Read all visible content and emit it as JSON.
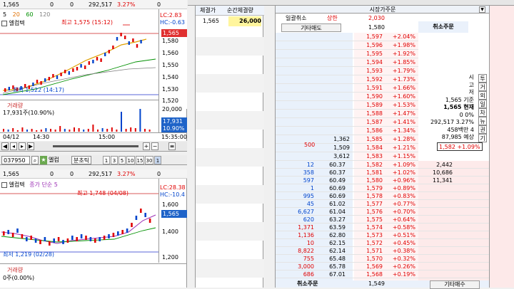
{
  "colors": {
    "up": "#e00000",
    "down": "#0044cc",
    "ask_bg": "#e9f1fb",
    "bid_bg": "#fdeaea",
    "price_col_bg": "#fff3f3",
    "accent": "#1e63c8"
  },
  "top_chart": {
    "info": {
      "price": "1,565",
      "change": "0",
      "volume": "0",
      "amount": "292,517",
      "rate": "3.27%",
      "extra": "0"
    },
    "legend": {
      "items": [
        "5",
        "20",
        "60",
        "120"
      ],
      "name": "엘컴텍"
    },
    "high_label": "최고 1,575 (15:12)",
    "low_label": "최저 1,522 (14:17)",
    "lc_label": "LC:2.83",
    "hc_label": "HC:-0.63",
    "price_box": "1,565",
    "y_ticks": [
      "1,580",
      "1,560",
      "1,550",
      "1,540",
      "1,530",
      "1,520"
    ],
    "volume_label": "거래량",
    "volume_value": "17,931주(10.90%)",
    "vol_ticks": [
      "20,000",
      "10,000"
    ],
    "vol_box": "17,931",
    "vol_box2": "10.90%",
    "x_labels": [
      "04/12",
      "14:30",
      "15:00",
      "15:35:00"
    ]
  },
  "toolbar": {
    "code": "037950",
    "name": "엘컴",
    "unit": "분초틱",
    "periods": [
      "1",
      "3",
      "5",
      "10",
      "15",
      "30",
      "1"
    ]
  },
  "bottom_chart": {
    "info": {
      "price": "1,565",
      "change": "0",
      "volume": "0",
      "amount": "292,517",
      "rate": "3.27%",
      "extra": "0"
    },
    "name": "엘컴텍",
    "legend": "종가 단순 5",
    "high_label": "최고 1,748 (04/08)",
    "low_label": "최저 1,219 (02/28)",
    "lc_label": "LC:28.38",
    "hc_label": "HC:-10.4",
    "price_box": "1,565",
    "y_ticks": [
      "1,600",
      "1,400",
      "1,200"
    ],
    "volume_label": "거래량",
    "volume_value": "0주(0.00%)"
  },
  "trades": {
    "headers": [
      "체결가",
      "순간체결량"
    ],
    "rows": [
      {
        "price": "1,565",
        "qty": "26,000"
      }
    ]
  },
  "order": {
    "title": "시장가주문",
    "top_row": {
      "a": "일괄취소",
      "b": "상한",
      "c": "2,030"
    },
    "sell_label": "기타매도",
    "sell_ref": "1,580",
    "cancel_label": "취소주문",
    "buy_label": "기타매수",
    "cancel_bottom": "취소주문",
    "bottom_price": "1,549",
    "side_tabs": [
      "투",
      "거",
      "외",
      "일",
      "차",
      "뉴",
      "권",
      "기"
    ],
    "center_info": [
      {
        "t": "시"
      },
      {
        "t": "고"
      },
      {
        "t": "저"
      },
      {
        "t": "1,565 기준"
      },
      {
        "t": "1,565 현재"
      },
      {
        "t": "0 0%"
      },
      {
        "t": "292,517 3.27%"
      },
      {
        "t": "458백만 4"
      },
      {
        "t": "87,985 예상"
      }
    ],
    "center_highlight": "1,582 +1.09%",
    "ask_rows": [
      {
        "qty": "",
        "price": "1,597",
        "rate": "+2.04%"
      },
      {
        "qty": "",
        "price": "1,596",
        "rate": "+1.98%"
      },
      {
        "qty": "",
        "price": "1,595",
        "rate": "+1.92%"
      },
      {
        "qty": "",
        "price": "1,594",
        "rate": "+1.85%"
      },
      {
        "qty": "",
        "price": "1,593",
        "rate": "+1.79%"
      },
      {
        "qty": "",
        "price": "1,592",
        "rate": "+1.73%"
      },
      {
        "qty": "",
        "price": "1,591",
        "rate": "+1.66%"
      },
      {
        "qty": "",
        "price": "1,590",
        "rate": "+1.60%"
      },
      {
        "qty": "",
        "price": "1,589",
        "rate": "+1.53%"
      },
      {
        "qty": "",
        "price": "1,588",
        "rate": "+1.47%"
      },
      {
        "qty": "",
        "price": "1,587",
        "rate": "+1.41%"
      },
      {
        "qty": "",
        "price": "1,586",
        "rate": "+1.34%"
      },
      {
        "qty": "1,362",
        "price": "1,585",
        "rate": "+1.28%"
      },
      {
        "qty": "1,509",
        "price": "1,584",
        "rate": "+1.21%"
      },
      {
        "qty": "3,612",
        "price": "1,583",
        "rate": "+1.15%"
      }
    ],
    "ask_side_note": {
      "qty": "500"
    },
    "bid_rows": [
      {
        "n": "12",
        "v": "60.37",
        "price": "1,582",
        "rate": "+1.09%",
        "bq": "2,442"
      },
      {
        "n": "358",
        "v": "60.37",
        "price": "1,581",
        "rate": "+1.02%",
        "bq": "10,686"
      },
      {
        "n": "597",
        "v": "60.49",
        "price": "1,580",
        "rate": "+0.96%",
        "bq": "11,341"
      },
      {
        "n": "1",
        "v": "60.69",
        "price": "1,579",
        "rate": "+0.89%",
        "bq": ""
      },
      {
        "n": "995",
        "v": "60.69",
        "price": "1,578",
        "rate": "+0.83%",
        "bq": ""
      },
      {
        "n": "45",
        "v": "61.02",
        "price": "1,577",
        "rate": "+0.77%",
        "bq": ""
      },
      {
        "n": "6,627",
        "v": "61.04",
        "price": "1,576",
        "rate": "+0.70%",
        "bq": ""
      },
      {
        "n": "620",
        "v": "63.27",
        "price": "1,575",
        "rate": "+0.64%",
        "bq": ""
      },
      {
        "n": "1,371",
        "v": "63.59",
        "price": "1,574",
        "rate": "+0.58%",
        "bq": ""
      },
      {
        "n": "1,136",
        "v": "62.80",
        "price": "1,573",
        "rate": "+0.51%",
        "bq": ""
      },
      {
        "n": "10",
        "v": "62.15",
        "price": "1,572",
        "rate": "+0.45%",
        "bq": ""
      },
      {
        "n": "8,822",
        "v": "62.14",
        "price": "1,571",
        "rate": "+0.38%",
        "bq": ""
      },
      {
        "n": "755",
        "v": "65.48",
        "price": "1,570",
        "rate": "+0.32%",
        "bq": ""
      },
      {
        "n": "3,000",
        "v": "65.78",
        "price": "1,569",
        "rate": "+0.26%",
        "bq": ""
      },
      {
        "n": "686",
        "v": "67.01",
        "price": "1,568",
        "rate": "+0.19%",
        "bq": ""
      }
    ]
  }
}
